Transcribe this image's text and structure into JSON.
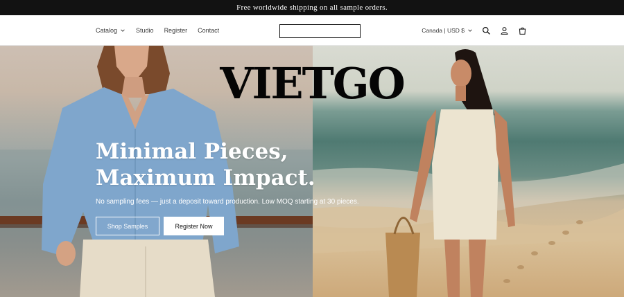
{
  "announcement": {
    "text": "Free worldwide shipping on all sample orders."
  },
  "nav": {
    "items": [
      {
        "label": "Catalog",
        "dropdown": true
      },
      {
        "label": "Studio"
      },
      {
        "label": "Register"
      },
      {
        "label": "Contact"
      }
    ]
  },
  "search": {
    "value": "",
    "placeholder": ""
  },
  "header_tools": {
    "locale_label": "Canada | USD $",
    "icons": [
      "search-icon",
      "account-icon",
      "cart-icon"
    ]
  },
  "brand": {
    "logo_text": "VIETGO"
  },
  "hero": {
    "headline_line1": "Minimal Pieces,",
    "headline_line2": "Maximum Impact.",
    "subtext": "No sampling fees — just a deposit toward production. Low MOQ starting at 30 pieces.",
    "primary_button": "Shop Samples",
    "secondary_button": "Register Now"
  },
  "colors": {
    "announcement_bg": "#121212",
    "text_dark": "#121212",
    "hero_text": "#ffffff"
  }
}
